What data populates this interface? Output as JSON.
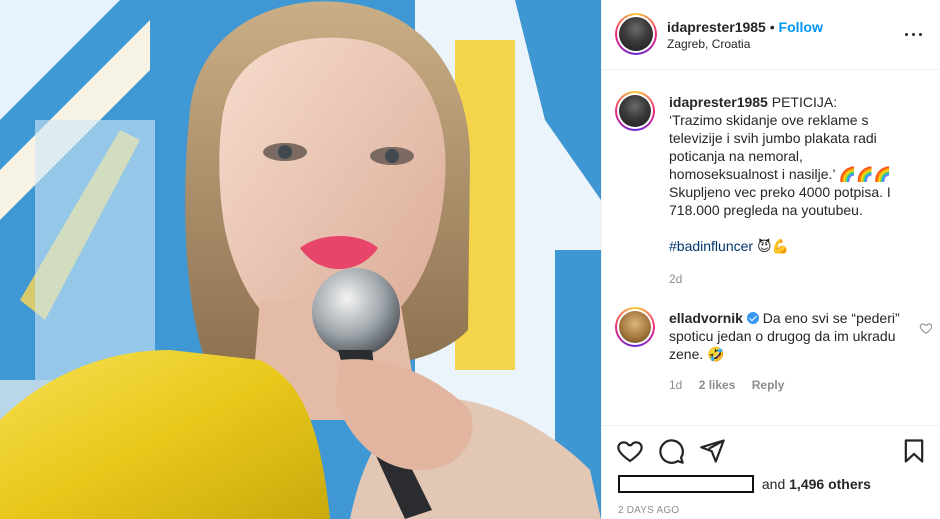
{
  "post": {
    "username": "idaprester1985",
    "follow_label": "Follow",
    "location": "Zagreb, Croatia",
    "more_label": "More options"
  },
  "caption": {
    "username": "idaprester1985",
    "text": "PETICIJA:\n‘Trazimo skidanje ove reklame s televizije i svih jumbo plakata radi poticanja na nemoral, homoseksualnost i nasilje.’ 🌈🌈🌈\nSkupljeno vec preko 4000 potpisa. I 718.000 pregleda na youtubeu.",
    "hashtag": "#badinfluncer",
    "hashtag_emoji": "😈💪",
    "age": "2d"
  },
  "comments": [
    {
      "username": "elladvornik",
      "verified": true,
      "text": "Da eno svi se “pederi” spoticu jedan o drugog da im ukradu zene. 🤣",
      "age": "1d",
      "likes": "2 likes",
      "reply_label": "Reply"
    }
  ],
  "actions": {
    "like_icon": "heart-icon",
    "comment_icon": "comment-icon",
    "share_icon": "share-icon",
    "save_icon": "bookmark-icon"
  },
  "likes_summary": {
    "connector": "and",
    "others": "1,496 others"
  },
  "timestamp": "2 DAYS AGO",
  "colors": {
    "follow": "#0095f6",
    "verified": "#3897f0",
    "meta_text": "#8e8e8e",
    "primary_text": "#262626"
  }
}
